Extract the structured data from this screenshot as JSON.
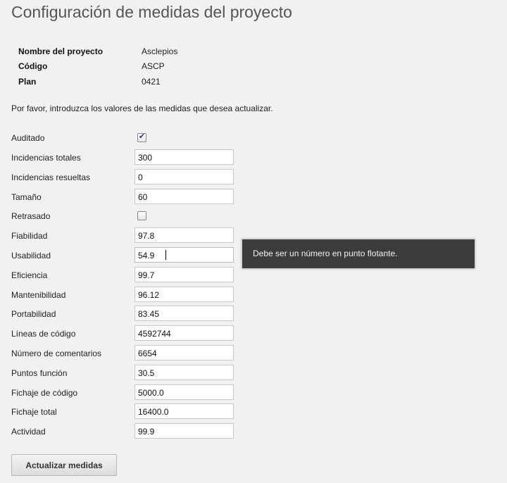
{
  "page": {
    "title": "Configuración de medidas del proyecto",
    "intro": "Por favor, introduzca los valores de las medidas que desea actualizar."
  },
  "project_info": [
    {
      "label": "Nombre del proyecto",
      "value": "Asclepios"
    },
    {
      "label": "Código",
      "value": "ASCP"
    },
    {
      "label": "Plan",
      "value": "0421"
    }
  ],
  "fields": {
    "auditado": {
      "label": "Auditado",
      "type": "checkbox",
      "checked": true
    },
    "incidencias_totales": {
      "label": "Incidencias totales",
      "value": "300"
    },
    "incidencias_resueltas": {
      "label": "Incidencias resueltas",
      "value": "0"
    },
    "tamano": {
      "label": "Tamaño",
      "value": "60"
    },
    "retrasado": {
      "label": "Retrasado",
      "type": "checkbox",
      "checked": false
    },
    "fiabilidad": {
      "label": "Fiabilidad",
      "value": "97.8"
    },
    "usabilidad": {
      "label": "Usabilidad",
      "value": "54.9",
      "focused": true
    },
    "eficiencia": {
      "label": "Eficiencia",
      "value": "99.7"
    },
    "mantenibilidad": {
      "label": "Mantenibilidad",
      "value": "96.12"
    },
    "portabilidad": {
      "label": "Portabilidad",
      "value": "83.45"
    },
    "lineas_codigo": {
      "label": "Líneas de código",
      "value": "4592744"
    },
    "numero_comentarios": {
      "label": "Número de comentarios",
      "value": "6654"
    },
    "puntos_funcion": {
      "label": "Puntos función",
      "value": "30.5"
    },
    "fichaje_codigo": {
      "label": "Fichaje de código",
      "value": "5000.0"
    },
    "fichaje_total": {
      "label": "Fichaje total",
      "value": "16400.0"
    },
    "actividad": {
      "label": "Actividad",
      "value": "99.9"
    }
  },
  "validation": {
    "message": "Debe ser un número en punto flotante."
  },
  "actions": {
    "submit_label": "Actualizar medidas"
  },
  "colors": {
    "background": "#f1f1f1",
    "tooltip_background": "#3c3c3c",
    "checkmark": "#2b3a7a"
  }
}
